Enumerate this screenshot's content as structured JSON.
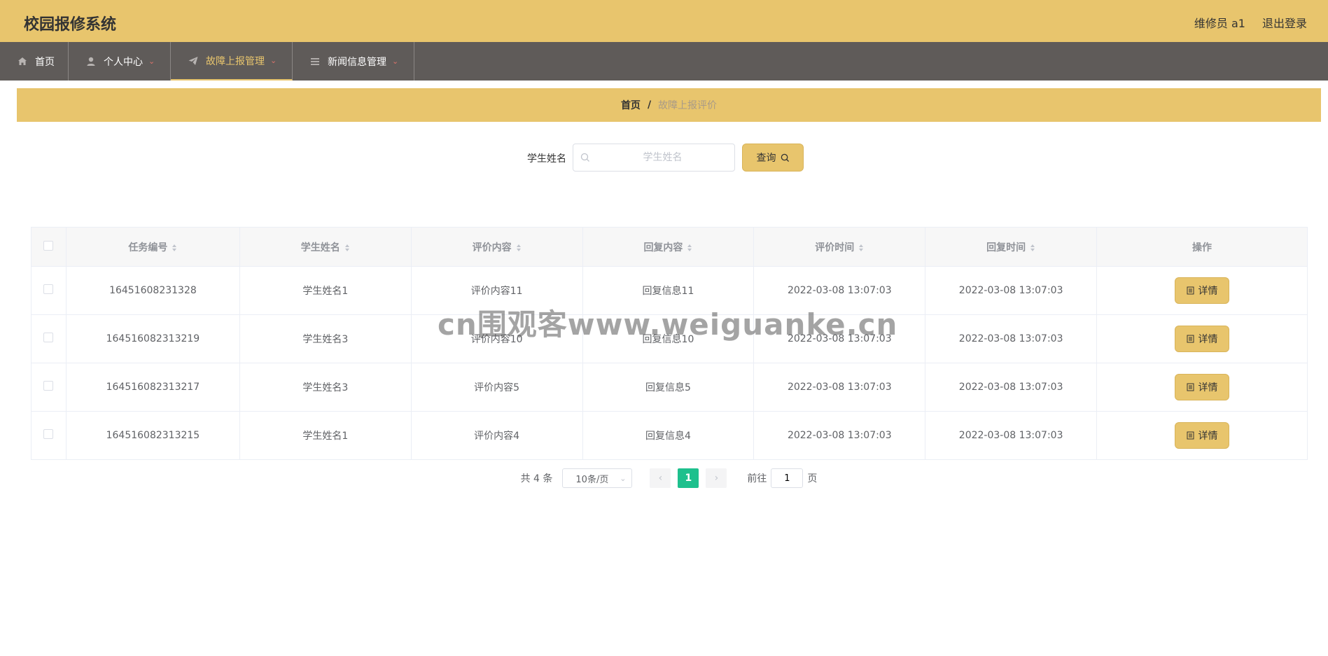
{
  "header": {
    "app_title": "校园报修系统",
    "user_label": "维修员 a1",
    "logout_label": "退出登录"
  },
  "nav": {
    "items": [
      {
        "label": "首页",
        "icon": "home-icon"
      },
      {
        "label": "个人中心",
        "icon": "user-icon"
      },
      {
        "label": "故障上报管理",
        "icon": "paper-plane-icon",
        "active": true
      },
      {
        "label": "新闻信息管理",
        "icon": "list-icon"
      }
    ]
  },
  "breadcrumb": {
    "home": "首页",
    "separator": "/",
    "current": "故障上报评价"
  },
  "search": {
    "label": "学生姓名",
    "placeholder": "学生姓名",
    "value": "",
    "button_label": "查询"
  },
  "table": {
    "columns": [
      "任务编号",
      "学生姓名",
      "评价内容",
      "回复内容",
      "评价时间",
      "回复时间",
      "操作"
    ],
    "rows": [
      {
        "task_no": "16451608231328",
        "student": "学生姓名1",
        "review": "评价内容11",
        "reply": "回复信息11",
        "review_time": "2022-03-08 13:07:03",
        "reply_time": "2022-03-08 13:07:03",
        "action": "详情"
      },
      {
        "task_no": "164516082313219",
        "student": "学生姓名3",
        "review": "评价内容10",
        "reply": "回复信息10",
        "review_time": "2022-03-08 13:07:03",
        "reply_time": "2022-03-08 13:07:03",
        "action": "详情"
      },
      {
        "task_no": "164516082313217",
        "student": "学生姓名3",
        "review": "评价内容5",
        "reply": "回复信息5",
        "review_time": "2022-03-08 13:07:03",
        "reply_time": "2022-03-08 13:07:03",
        "action": "详情"
      },
      {
        "task_no": "164516082313215",
        "student": "学生姓名1",
        "review": "评价内容4",
        "reply": "回复信息4",
        "review_time": "2022-03-08 13:07:03",
        "reply_time": "2022-03-08 13:07:03",
        "action": "详情"
      }
    ]
  },
  "pagination": {
    "total": "共 4 条",
    "page_size": "10条/页",
    "current_page": "1",
    "goto_label": "前往",
    "goto_value": "1",
    "page_suffix": "页"
  },
  "watermark": "cn围观客www.weiguanke.cn",
  "colors": {
    "accent": "#e8c56d",
    "nav_bg": "#5f5b59",
    "page_active": "#1ec08d"
  }
}
